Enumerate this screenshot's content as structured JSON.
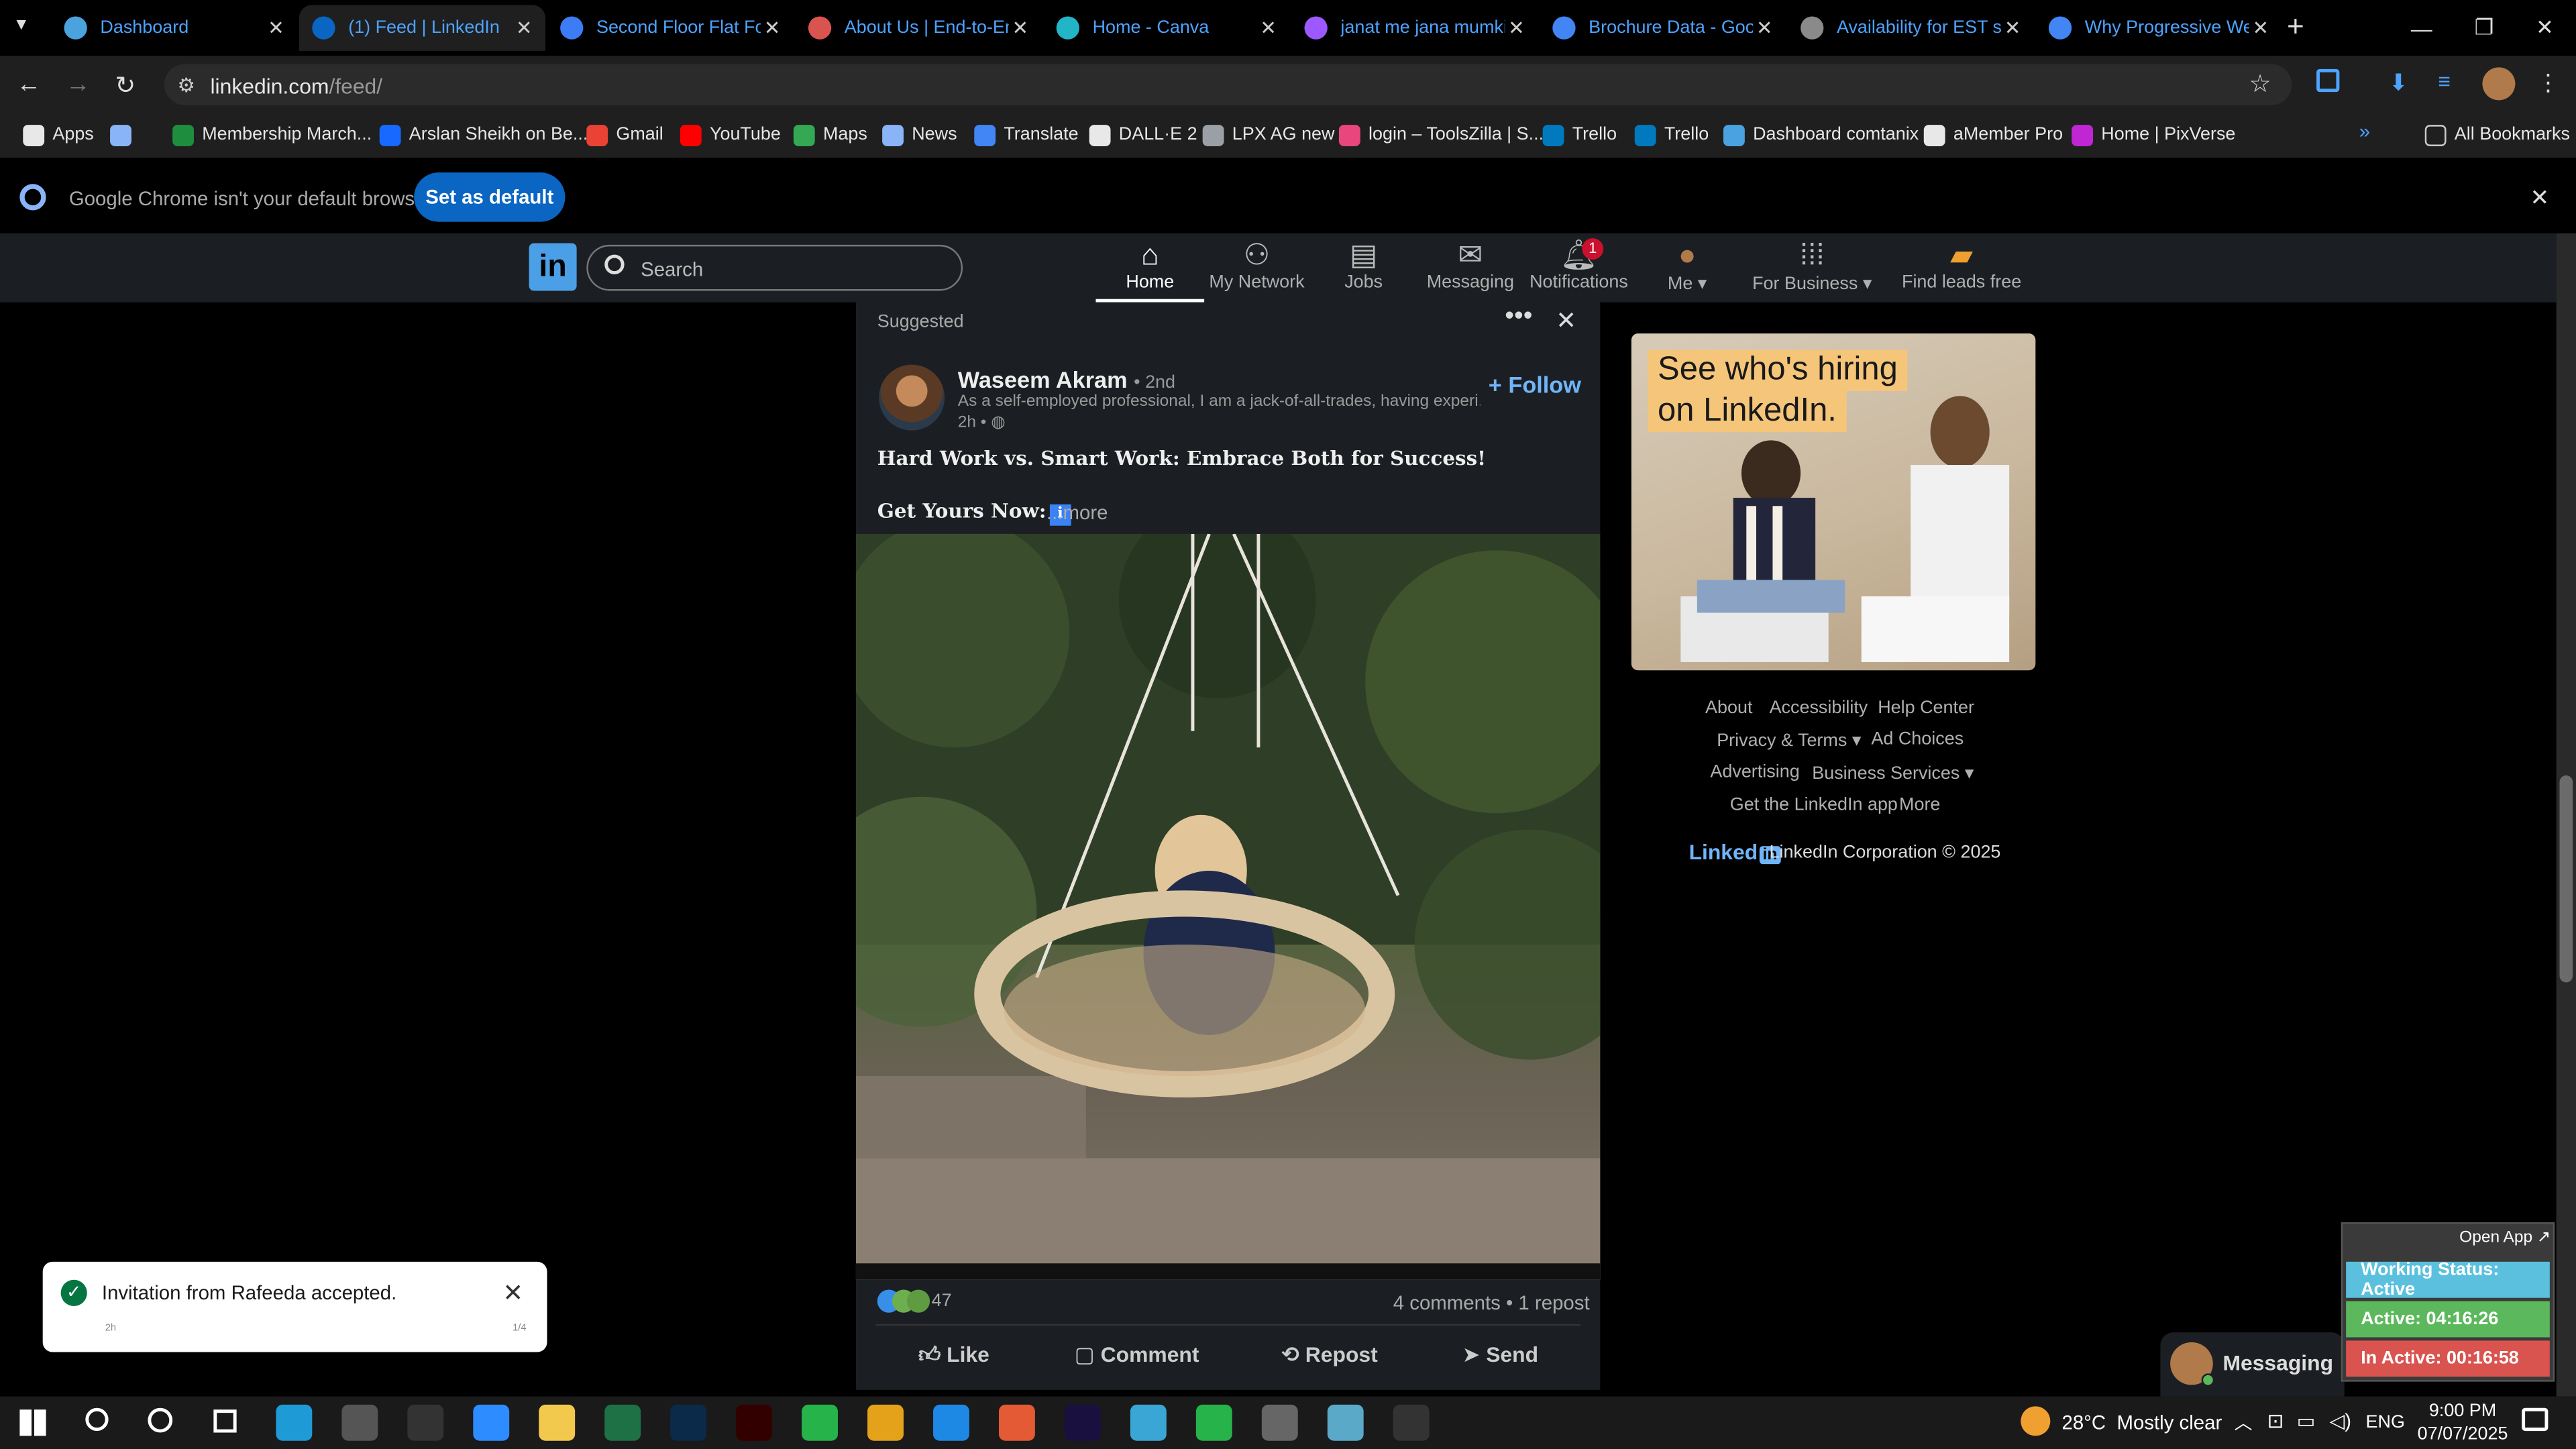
{
  "browser": {
    "tabs": [
      {
        "label": "Dashboard",
        "fav": "#4aa3df",
        "active": false
      },
      {
        "label": "(1) Feed | LinkedIn",
        "fav": "#0a66c2",
        "active": true
      },
      {
        "label": "Second Floor Flat For",
        "fav": "#3c7cf4",
        "active": false
      },
      {
        "label": "About Us | End-to-En",
        "fav": "#d9534f",
        "active": false
      },
      {
        "label": "Home - Canva",
        "fav": "#22b5c7",
        "active": false
      },
      {
        "label": "janat me jana mumki",
        "fav": "#9b59ff",
        "active": false
      },
      {
        "label": "Brochure Data - Goo",
        "fav": "#4285f4",
        "active": false
      },
      {
        "label": "Availability for EST sh",
        "fav": "#8a8a8a",
        "active": false
      },
      {
        "label": "Why Progressive Web",
        "fav": "#4285f4",
        "active": false
      }
    ],
    "url_host": "linkedin.com",
    "url_path": "/feed/",
    "bookmarks": [
      {
        "label": "Apps",
        "color": "#e8e8e8"
      },
      {
        "label": "",
        "color": "#8ab4f8"
      },
      {
        "label": "Membership March...",
        "color": "#1e8e3e"
      },
      {
        "label": "Arslan Sheikh on Be...",
        "color": "#1769ff"
      },
      {
        "label": "Gmail",
        "color": "#ea4335"
      },
      {
        "label": "YouTube",
        "color": "#ff0000"
      },
      {
        "label": "Maps",
        "color": "#34a853"
      },
      {
        "label": "News",
        "color": "#8ab4f8"
      },
      {
        "label": "Translate",
        "color": "#4285f4"
      },
      {
        "label": "DALL·E 2",
        "color": "#e8e8e8"
      },
      {
        "label": "LPX AG new",
        "color": "#9aa0a6"
      },
      {
        "label": "login – ToolsZilla | S...",
        "color": "#e8467c"
      },
      {
        "label": "Trello",
        "color": "#0079bf"
      },
      {
        "label": "Trello",
        "color": "#0079bf"
      },
      {
        "label": "Dashboard comtanix",
        "color": "#4aa3df"
      },
      {
        "label": "aMember Pro",
        "color": "#e8e8e8"
      },
      {
        "label": "Home | PixVerse",
        "color": "#c026d3"
      }
    ],
    "all_bookmarks": "All Bookmarks",
    "infobar_text": "Google Chrome isn't your default browser",
    "set_default": "Set as default"
  },
  "linkedin": {
    "search_placeholder": "Search",
    "nav": [
      {
        "label": "Home",
        "icon": "home-icon"
      },
      {
        "label": "My Network",
        "icon": "network-icon"
      },
      {
        "label": "Jobs",
        "icon": "briefcase-icon"
      },
      {
        "label": "Messaging",
        "icon": "messaging-icon"
      },
      {
        "label": "Notifications",
        "icon": "bell-icon"
      },
      {
        "label": "Me",
        "icon": "avatar"
      },
      {
        "label": "For Business",
        "icon": "grid-icon"
      },
      {
        "label": "Find leads free",
        "icon": "leads-icon"
      }
    ],
    "notification_count": "1",
    "post": {
      "suggested": "Suggested",
      "author": "Waseem Akram",
      "degree": "• 2nd",
      "headline": "As a self-employed professional, I am a jack-of-all-trades, having experi...",
      "time": "2h •",
      "follow": "Follow",
      "title": "Hard Work vs. Smart Work: Embrace Both for Success!",
      "get_yours": "Get Yours Now:",
      "more": "...more",
      "reactions": "47",
      "comments": "4 comments • 1 repost",
      "actions": [
        "Like",
        "Comment",
        "Repost",
        "Send"
      ]
    },
    "ad": {
      "line1": "See who's hiring",
      "line2": "on LinkedIn."
    },
    "footer": {
      "about": "About",
      "accessibility": "Accessibility",
      "help": "Help Center",
      "privacy": "Privacy & Terms",
      "adchoices": "Ad Choices",
      "advertising": "Advertising",
      "business": "Business Services",
      "app": "Get the LinkedIn app",
      "more": "More",
      "logo_text": "Linked",
      "copyright": "LinkedIn Corporation © 2025"
    },
    "messaging": "Messaging",
    "toast": {
      "text": "Invitation from Rafeeda accepted.",
      "left_meta": "2h",
      "right_meta": "1/4"
    }
  },
  "overlay": {
    "open_app": "Open App ↗",
    "working": "Working Status: Active",
    "active": "Active: 04:16:26",
    "inactive": "In Active: 00:16:58",
    "colors": {
      "working": "#5bc0de",
      "active": "#5cb85c",
      "inactive": "#d9534f"
    }
  },
  "taskbar": {
    "weather": "28°C  Mostly clear",
    "lang": "ENG",
    "time": "9:00 PM",
    "date": "07/07/2025"
  }
}
